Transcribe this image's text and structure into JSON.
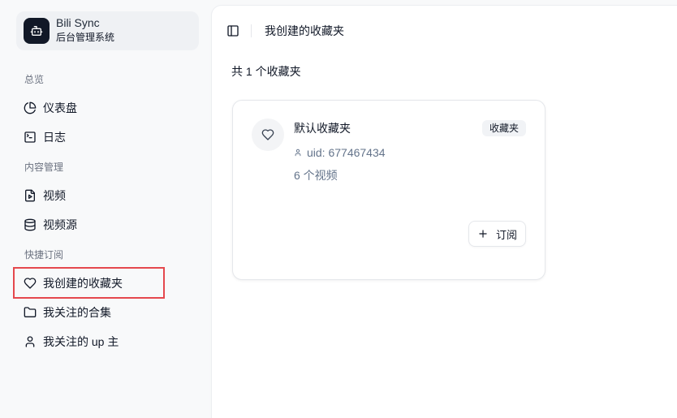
{
  "app": {
    "name": "Bili Sync",
    "subtitle": "后台管理系统",
    "logo_icon": "bot-icon"
  },
  "sidebar": {
    "groups": [
      {
        "label": "总览",
        "items": [
          {
            "label": "仪表盘",
            "icon": "pie-chart-icon"
          },
          {
            "label": "日志",
            "icon": "terminal-icon"
          }
        ]
      },
      {
        "label": "内容管理",
        "items": [
          {
            "label": "视频",
            "icon": "file-video-icon"
          },
          {
            "label": "视频源",
            "icon": "database-icon"
          }
        ]
      },
      {
        "label": "快捷订阅",
        "items": [
          {
            "label": "我创建的收藏夹",
            "icon": "heart-icon",
            "highlighted": true
          },
          {
            "label": "我关注的合集",
            "icon": "folder-icon"
          },
          {
            "label": "我关注的 up 主",
            "icon": "user-icon"
          }
        ]
      }
    ]
  },
  "header": {
    "toggle_icon": "panel-left-icon",
    "breadcrumb": "我创建的收藏夹"
  },
  "main": {
    "count_text": "共 1 个收藏夹",
    "favorites": [
      {
        "icon": "heart-icon",
        "title": "默认收藏夹",
        "badge": "收藏夹",
        "uid_icon": "user-icon",
        "uid": "uid: 677467434",
        "video_count": "6 个视频",
        "action_icon": "plus-icon",
        "action_label": "订阅"
      }
    ]
  },
  "colors": {
    "sidebar_bg": "#f8f9fa",
    "panel_bg": "#ffffff",
    "brand_card_bg": "#eff1f4",
    "logo_bg": "#111827",
    "text": "#111827",
    "muted_text": "#64748b",
    "border": "#e5e7eb",
    "highlight": "#e5484d"
  }
}
